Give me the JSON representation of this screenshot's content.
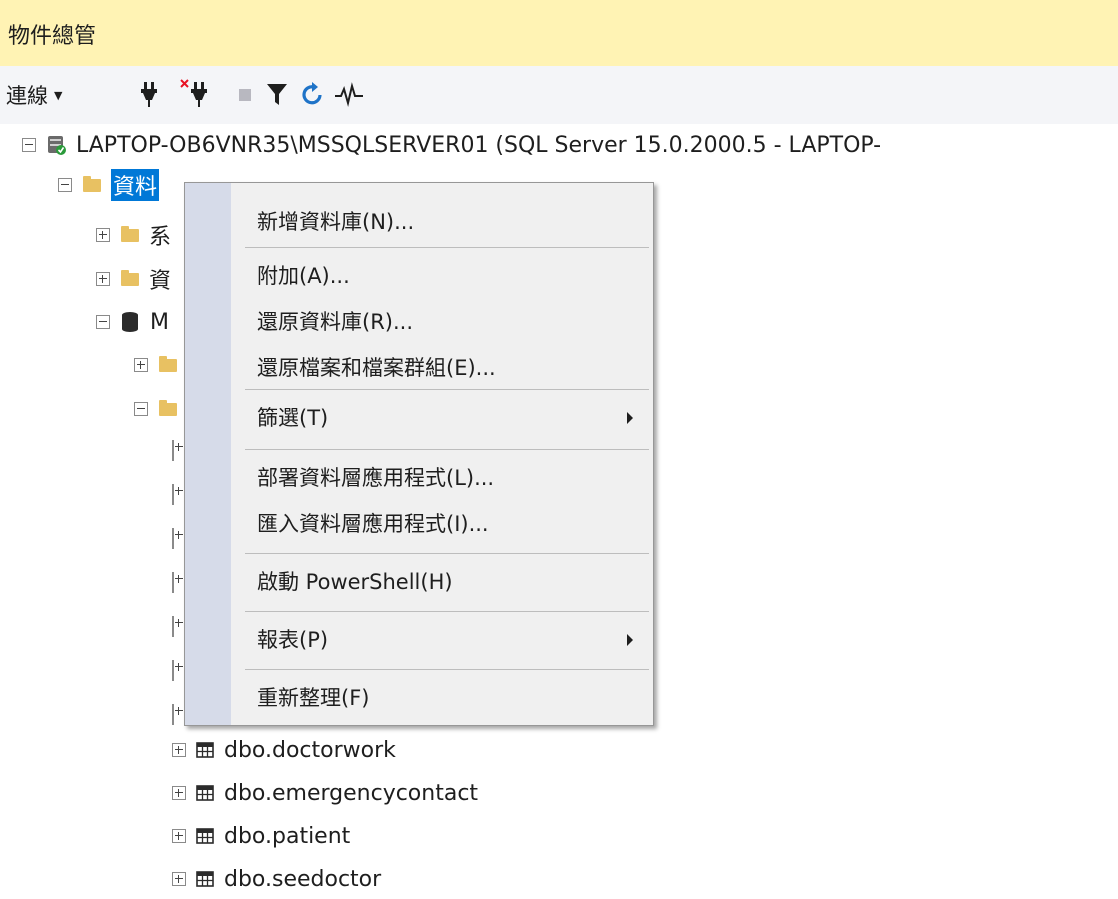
{
  "panel": {
    "title": "物件總管"
  },
  "toolbar": {
    "connect_label": "連線",
    "icons": [
      "connect-plug-icon",
      "disconnect-plug-icon",
      "stop-icon",
      "filter-icon",
      "refresh-icon",
      "activity-monitor-icon"
    ]
  },
  "tree": {
    "server": "LAPTOP-OB6VNR35\\MSSQLSERVER01 (SQL Server 15.0.2000.5 - LAPTOP-",
    "databases_label_visible": "資料",
    "partial_nodes": [
      "系",
      "資",
      "M"
    ],
    "tables": [
      "dbo.doctorwork",
      "dbo.emergencycontact",
      "dbo.patient",
      "dbo.seedoctor"
    ]
  },
  "context_menu": {
    "items": [
      {
        "label": "新增資料庫(N)..."
      },
      {
        "label": "附加(A)..."
      },
      {
        "label": "還原資料庫(R)..."
      },
      {
        "label": "還原檔案和檔案群組(E)..."
      },
      {
        "label": "篩選(T)",
        "submenu": true
      },
      {
        "label": "部署資料層應用程式(L)..."
      },
      {
        "label": "匯入資料層應用程式(I)..."
      },
      {
        "label": "啟動 PowerShell(H)"
      },
      {
        "label": "報表(P)",
        "submenu": true
      },
      {
        "label": "重新整理(F)"
      }
    ]
  },
  "colors": {
    "title_bg": "#fff3b4",
    "selection": "#0078d7",
    "menu_gutter": "#d6dbe9",
    "folder": "#e8c162"
  }
}
